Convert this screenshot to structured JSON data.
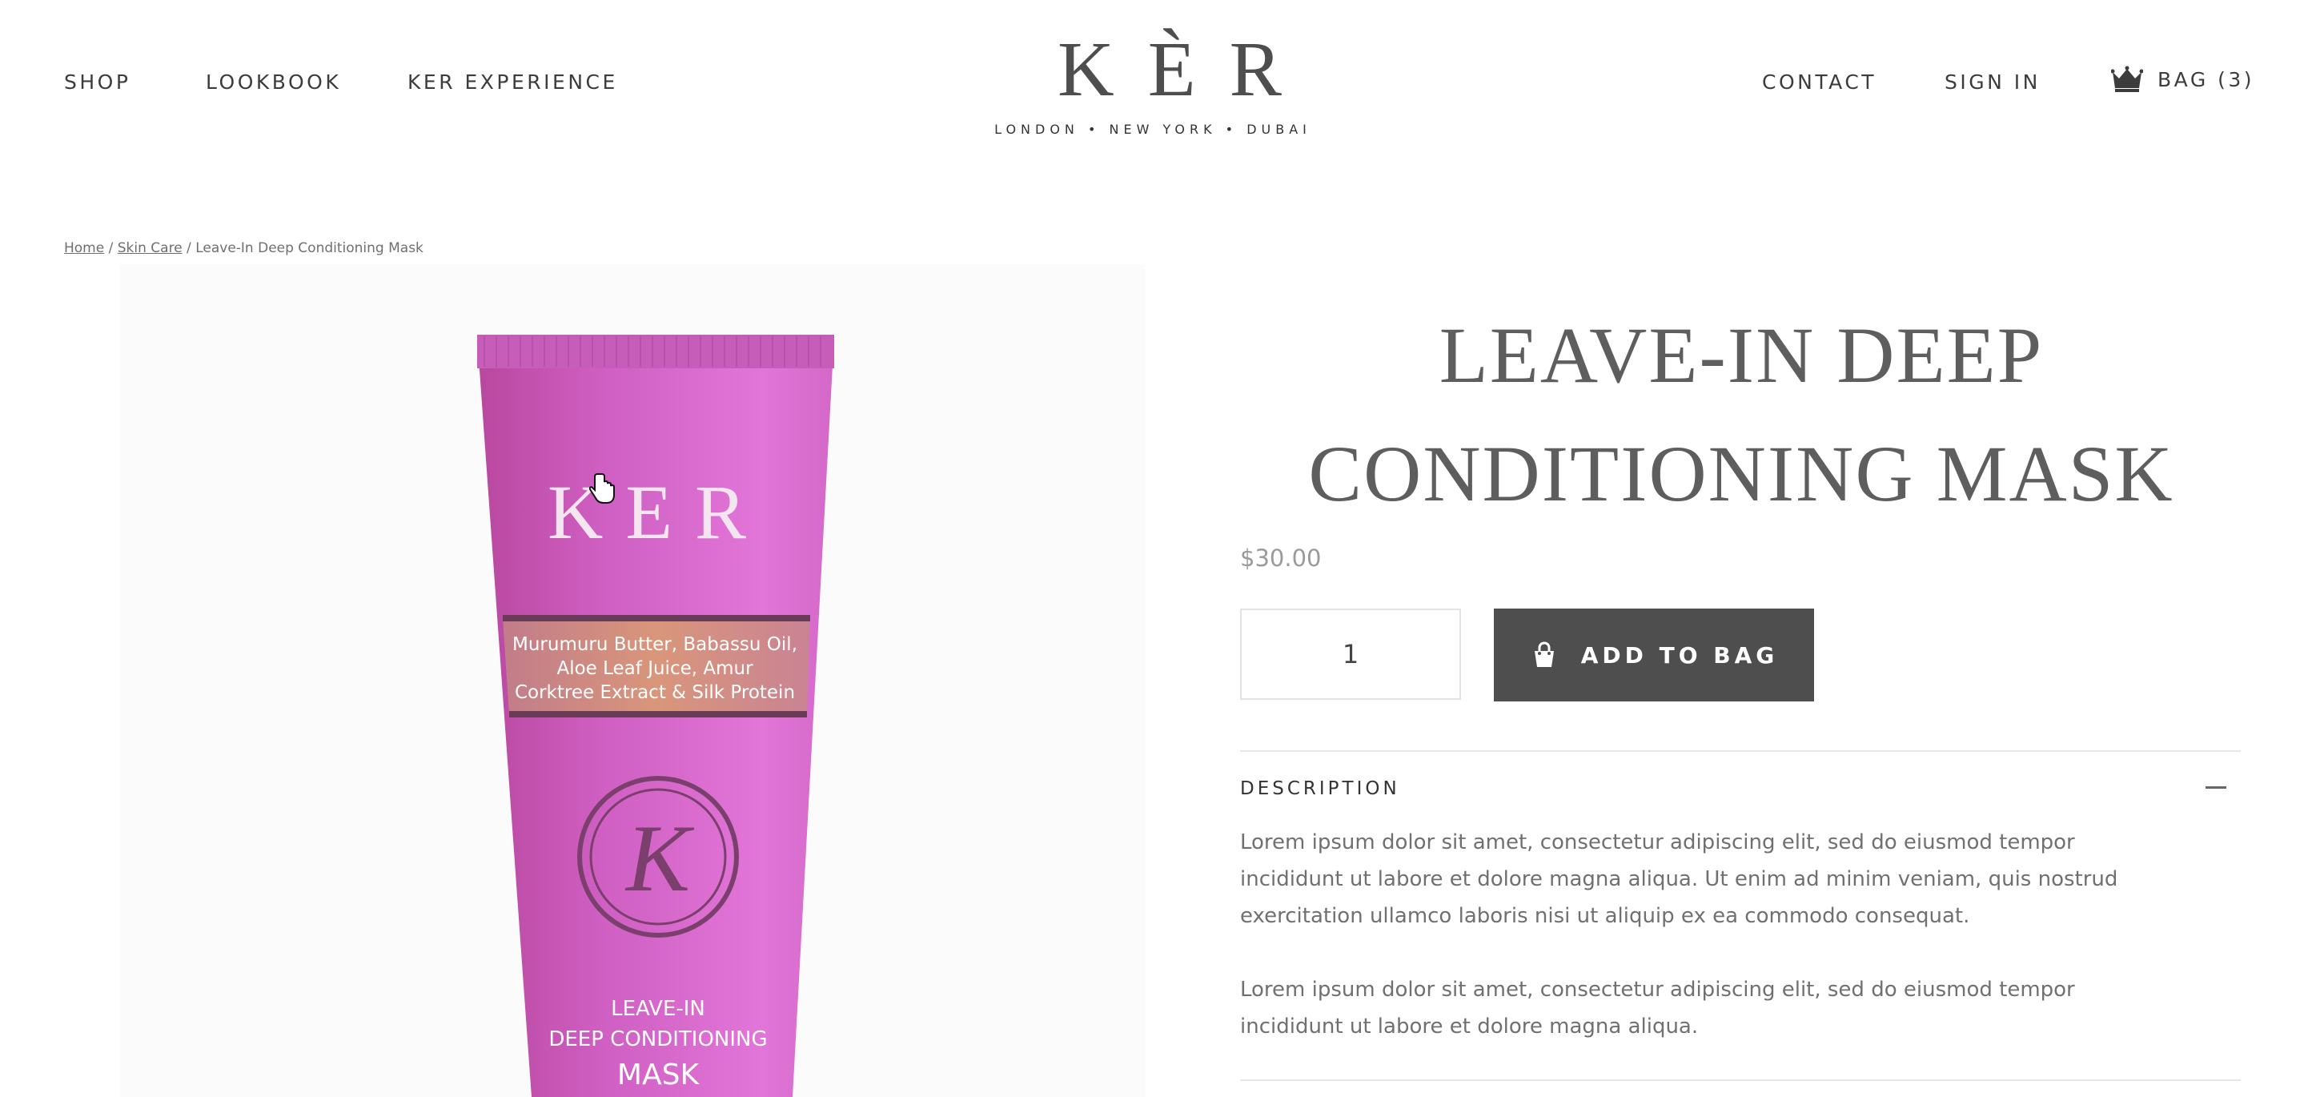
{
  "header": {
    "nav_left": [
      "SHOP",
      "LOOKBOOK",
      "KER EXPERIENCE"
    ],
    "logo": "KÈR",
    "logo_tagline": "LONDON • NEW YORK • DUBAI",
    "nav_right": {
      "contact": "CONTACT",
      "sign_in": "SIGN IN",
      "bag": "BAG (3)"
    }
  },
  "breadcrumb": {
    "home": "Home",
    "sep1": " / ",
    "category": "Skin Care",
    "sep2": " / ",
    "current": "Leave-In Deep Conditioning Mask"
  },
  "product_image": {
    "brand": "KER",
    "ingredients": [
      "Murumuru Butter, Babassu Oil,",
      "Aloe Leaf Juice, Amur",
      "Corktree Extract & Silk Protein"
    ],
    "monogram": "K",
    "label_lines": [
      "LEAVE-IN",
      "DEEP CONDITIONING",
      "MASK"
    ],
    "tube_color": "#d467c8"
  },
  "product": {
    "title_line1": "LEAVE-IN DEEP",
    "title_line2": "CONDITIONING MASK",
    "price": "$30.00",
    "quantity": "1",
    "add_to_bag": "ADD TO BAG"
  },
  "description": {
    "heading": "DESCRIPTION",
    "paragraph1": "Lorem ipsum dolor sit amet, consectetur adipiscing elit, sed do eiusmod tempor incididunt ut labore et dolore magna aliqua. Ut enim ad minim veniam, quis nostrud exercitation ullamco laboris nisi ut aliquip ex ea commodo consequat.",
    "paragraph2": "Lorem ipsum dolor sit amet, consectetur adipiscing elit, sed do eiusmod tempor incididunt ut labore et dolore magna aliqua."
  },
  "colors": {
    "button": "#4e4e4e",
    "text": "#707070",
    "title": "#5e5e5e",
    "price": "#9a9a9a"
  }
}
